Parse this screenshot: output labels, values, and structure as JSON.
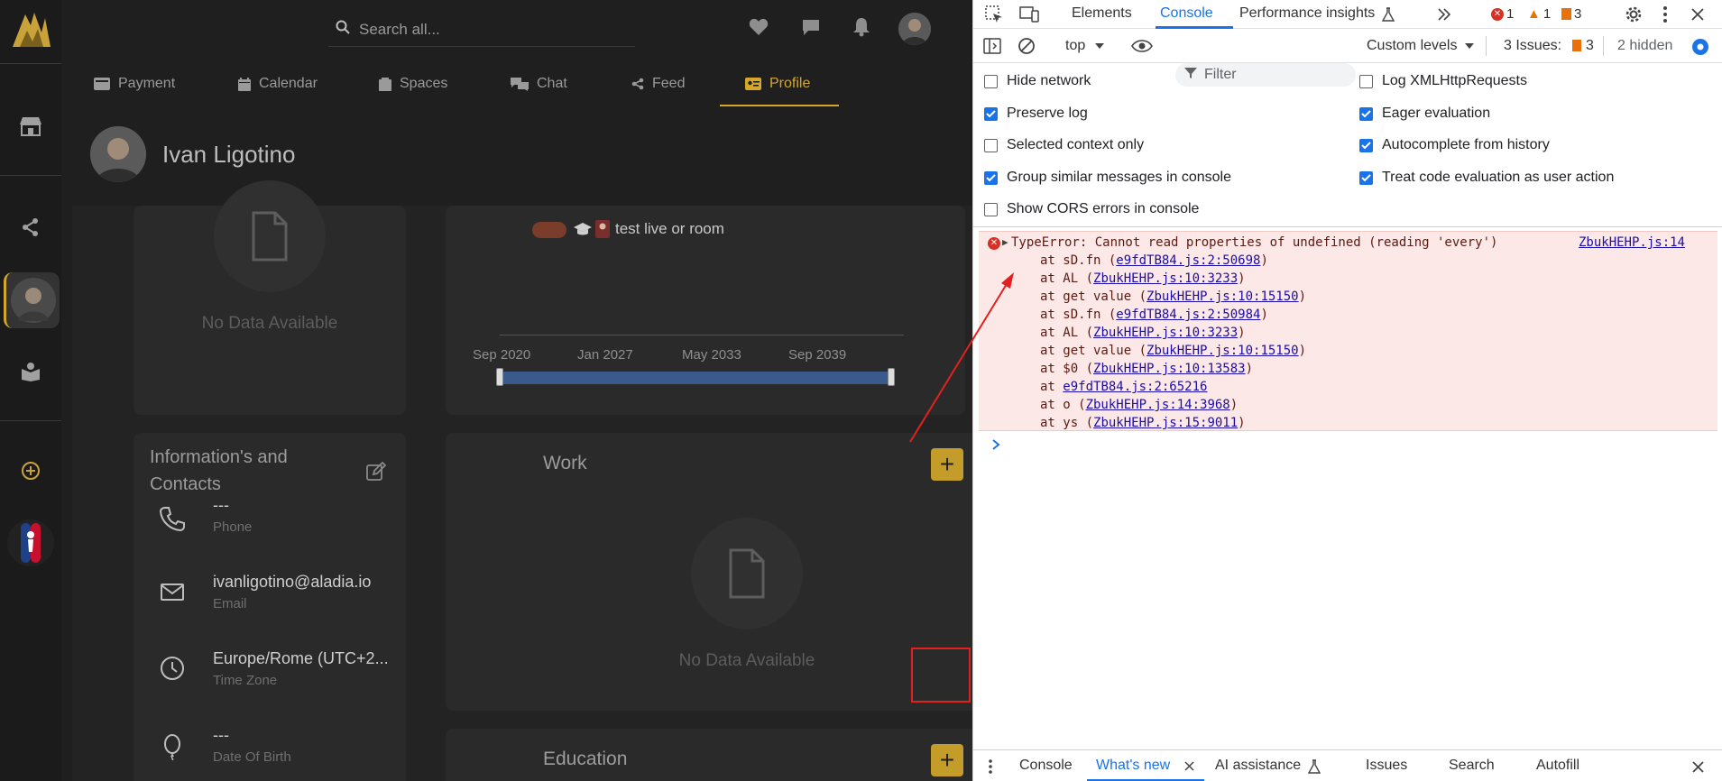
{
  "app": {
    "search_placeholder": "Search all...",
    "tabs": [
      "Payment",
      "Calendar",
      "Spaces",
      "Chat",
      "Feed",
      "Profile"
    ],
    "profile_name": "Ivan Ligotino",
    "no_data": "No Data Available",
    "timeline": {
      "event_text": "test live or room",
      "labels": [
        "Sep 2020",
        "Jan 2027",
        "May 2033",
        "Sep 2039"
      ]
    },
    "info": {
      "title_line1": "Information's and",
      "title_line2": "Contacts",
      "rows": [
        {
          "value": "---",
          "label": "Phone"
        },
        {
          "value": "ivanligotino@aladia.io",
          "label": "Email"
        },
        {
          "value": "Europe/Rome (UTC+2...",
          "label": "Time Zone"
        },
        {
          "value": "---",
          "label": "Date Of Birth"
        }
      ]
    },
    "work_title": "Work",
    "education_title": "Education",
    "add_symbol": "+",
    "accent_color": "#d4a72c"
  },
  "devtools": {
    "tabs": [
      "Elements",
      "Console",
      "Performance insights"
    ],
    "error_count": "1",
    "warning_count": "1",
    "info_count": "3",
    "context": "top",
    "filter_placeholder": "Filter",
    "levels": "Custom levels",
    "issues_label": "3 Issues:",
    "issues_count": "3",
    "hidden_label": "2 hidden",
    "options": [
      {
        "label": "Hide network",
        "checked": false
      },
      {
        "label": "Log XMLHttpRequests",
        "checked": false
      },
      {
        "label": "Preserve log",
        "checked": true
      },
      {
        "label": "Eager evaluation",
        "checked": true
      },
      {
        "label": "Selected context only",
        "checked": false
      },
      {
        "label": "Autocomplete from history",
        "checked": true
      },
      {
        "label": "Group similar messages in console",
        "checked": true
      },
      {
        "label": "Treat code evaluation as user action",
        "checked": true
      },
      {
        "label": "Show CORS errors in console",
        "checked": false
      }
    ],
    "error": {
      "message": "TypeError: Cannot read properties of undefined (reading 'every')",
      "source": "ZbukHEHP.js:14",
      "stack": [
        {
          "pre": "at sD.fn (",
          "link": "e9fdTB84.js:2:50698",
          "post": ")"
        },
        {
          "pre": "at AL (",
          "link": "ZbukHEHP.js:10:3233",
          "post": ")"
        },
        {
          "pre": "at get value (",
          "link": "ZbukHEHP.js:10:15150",
          "post": ")"
        },
        {
          "pre": "at sD.fn (",
          "link": "e9fdTB84.js:2:50984",
          "post": ")"
        },
        {
          "pre": "at AL (",
          "link": "ZbukHEHP.js:10:3233",
          "post": ")"
        },
        {
          "pre": "at get value (",
          "link": "ZbukHEHP.js:10:15150",
          "post": ")"
        },
        {
          "pre": "at $0 (",
          "link": "ZbukHEHP.js:10:13583",
          "post": ")"
        },
        {
          "pre": "at ",
          "link": "e9fdTB84.js:2:65216",
          "post": ""
        },
        {
          "pre": "at o (",
          "link": "ZbukHEHP.js:14:3968",
          "post": ")"
        },
        {
          "pre": "at ys (",
          "link": "ZbukHEHP.js:15:9011",
          "post": ")"
        }
      ]
    },
    "drawer_tabs": [
      "Console",
      "What's new",
      "AI assistance",
      "Issues",
      "Search",
      "Autofill"
    ]
  }
}
